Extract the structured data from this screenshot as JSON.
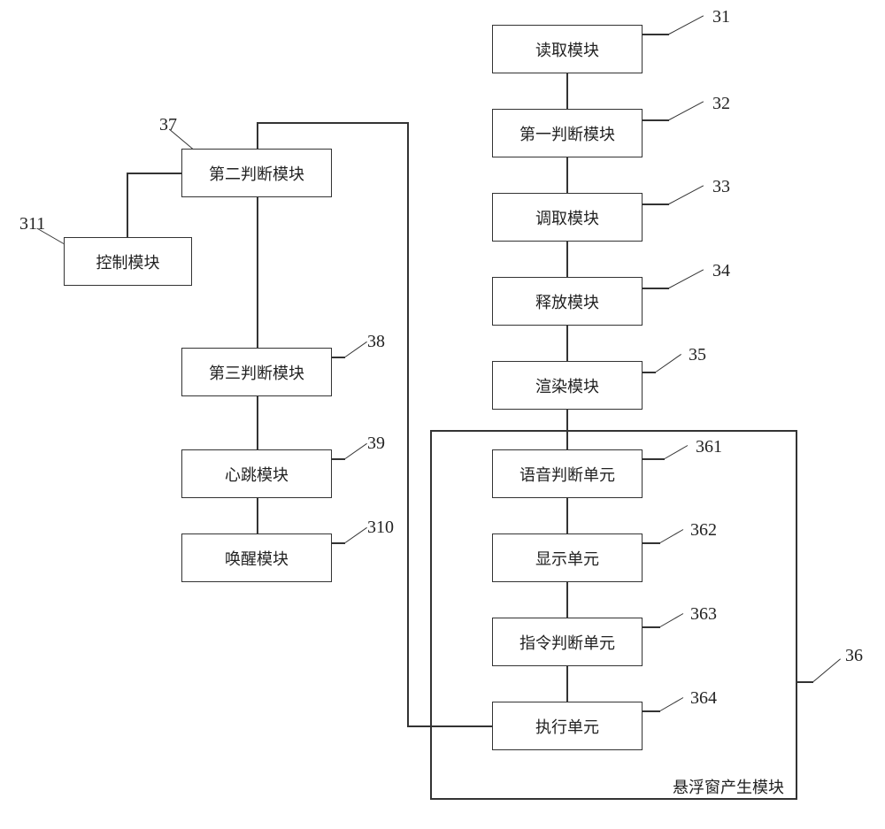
{
  "boxes": {
    "b31": {
      "label": "读取模块",
      "num": "31"
    },
    "b32": {
      "label": "第一判断模块",
      "num": "32"
    },
    "b33": {
      "label": "调取模块",
      "num": "33"
    },
    "b34": {
      "label": "释放模块",
      "num": "34"
    },
    "b35": {
      "label": "渲染模块",
      "num": "35"
    },
    "b361": {
      "label": "语音判断单元",
      "num": "361"
    },
    "b362": {
      "label": "显示单元",
      "num": "362"
    },
    "b363": {
      "label": "指令判断单元",
      "num": "363"
    },
    "b364": {
      "label": "执行单元",
      "num": "364"
    },
    "b36": {
      "label": "悬浮窗产生模块",
      "num": "36"
    },
    "b37": {
      "label": "第二判断模块",
      "num": "37"
    },
    "b38": {
      "label": "第三判断模块",
      "num": "38"
    },
    "b39": {
      "label": "心跳模块",
      "num": "39"
    },
    "b310": {
      "label": "唤醒模块",
      "num": "310"
    },
    "b311": {
      "label": "控制模块",
      "num": "311"
    }
  }
}
